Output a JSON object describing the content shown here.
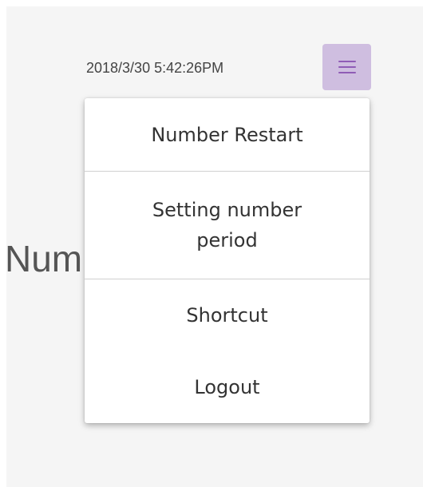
{
  "header": {
    "datetime": "2018/3/30 5:42:26PM",
    "menu_icon": "hamburger-menu-icon"
  },
  "background": {
    "partial_label": "Num"
  },
  "menu": {
    "items": [
      {
        "label": "Number Restart"
      },
      {
        "label": "Setting number period"
      },
      {
        "label": "Shortcut"
      },
      {
        "label": "Logout"
      }
    ]
  },
  "colors": {
    "menu_button_bg": "#cfbee0",
    "menu_icon": "#8f5cb6",
    "panel_bg": "#f5f5f5"
  }
}
